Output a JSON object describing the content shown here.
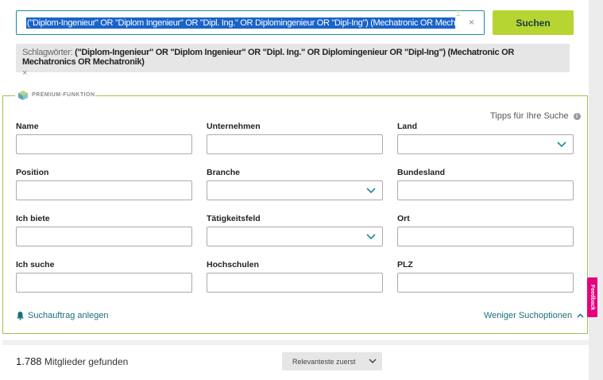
{
  "search": {
    "query": "(\"Diplom-Ingenieur\" OR \"Diplom Ingenieur\" OR \"Dipl. Ing.\" OR Diplomingenieur OR \"Dipl-Ing\")  (Mechatronic OR Mechatronics",
    "clear_symbol": "×",
    "button_label": "Suchen"
  },
  "keywords": {
    "label": "Schlagwörter:",
    "value": "(\"Diplom-Ingenieur\" OR \"Diplom Ingenieur\" OR \"Dipl. Ing.\" OR Diplomingenieur OR \"Dipl-Ing\") (Mechatronic OR Mechatronics OR Mechatronik)",
    "remove_symbol": "×"
  },
  "premium": {
    "label": "PREMIUM-FUNKTION",
    "tips_label": "Tipps für Ihre Suche",
    "info_symbol": "i"
  },
  "fields": {
    "name": "Name",
    "position": "Position",
    "ich_biete": "Ich biete",
    "ich_suche": "Ich suche",
    "unternehmen": "Unternehmen",
    "branche": "Branche",
    "taetigkeitsfeld": "Tätigkeitsfeld",
    "hochschulen": "Hochschulen",
    "land": "Land",
    "bundesland": "Bundesland",
    "ort": "Ort",
    "plz": "PLZ"
  },
  "actions": {
    "search_alert": "Suchauftrag anlegen",
    "fewer_options": "Weniger Suchoptionen"
  },
  "feedback_tab": "Feedback",
  "results": {
    "count": "1.788",
    "label": "Mitglieder gefunden",
    "sort_selected": "Relevanteste zuerst"
  },
  "colors": {
    "accent_teal": "#1e8b9a",
    "button_green": "#b6d532",
    "premium_border": "#9bc54a",
    "feedback_pink": "#e6007e"
  }
}
